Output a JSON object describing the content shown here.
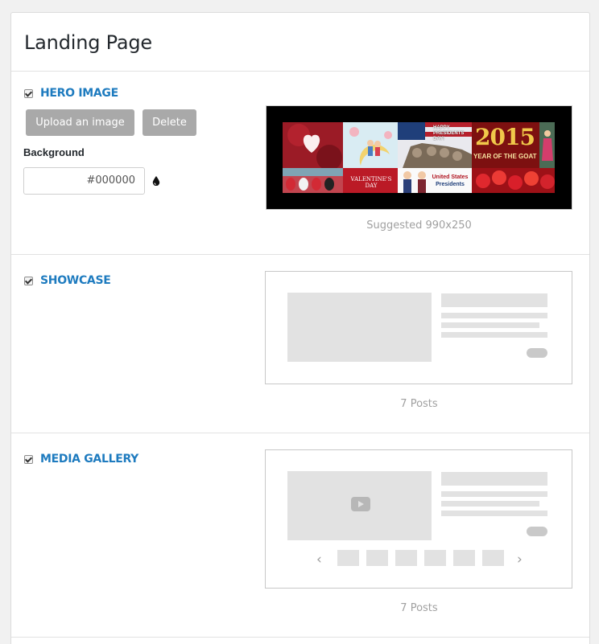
{
  "page": {
    "title": "Landing Page"
  },
  "hero": {
    "title": "HERO IMAGE",
    "checked": true,
    "upload_label": "Upload an image",
    "delete_label": "Delete",
    "background_label": "Background",
    "background_value": "#000000",
    "caption": "Suggested 990x250",
    "tiles": {
      "presidents_day": "HAPPY PRESIDENTS DAY!",
      "year_number": "2015",
      "year_caption": "YEAR OF THE GOAT",
      "valentines": "VALENTINE'S DAY",
      "presidents_line1": "United States",
      "presidents_line2": "Presidents"
    }
  },
  "showcase": {
    "title": "SHOWCASE",
    "checked": true,
    "caption": "7 Posts"
  },
  "gallery": {
    "title": "MEDIA GALLERY",
    "checked": true,
    "caption": "7 Posts",
    "prev_glyph": "‹",
    "next_glyph": "›"
  },
  "colors": {
    "accent": "#1e7bbf",
    "button": "#a9a9a9",
    "placeholder": "#e2e2e2"
  }
}
